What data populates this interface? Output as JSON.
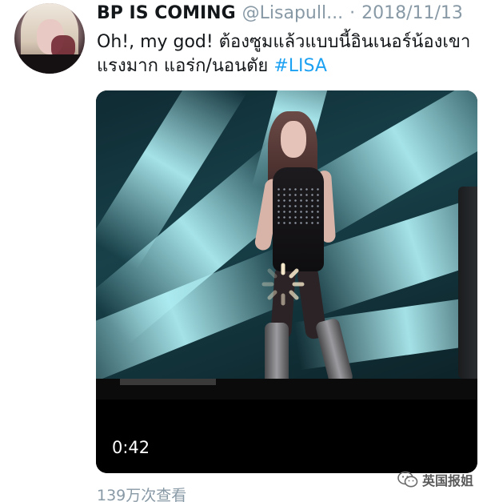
{
  "tweet": {
    "display_name": "BP IS COMING",
    "handle": "@Lisapull...",
    "separator": "·",
    "date": "2018/11/13",
    "text_plain": "Oh!, my god! ต้องซูมแล้วแบบนี้อินเนอร์น้องเขาแรงมาก แอร่ก/นอนตัย ",
    "hashtag": "#LISA",
    "views": "139万次查看"
  },
  "video": {
    "duration": "0:42"
  },
  "watermark": {
    "text": "英国报姐",
    "icon": "wechat-icon"
  },
  "colors": {
    "hashtag": "#1da1f2",
    "muted": "#8899a6",
    "text": "#14171a"
  }
}
